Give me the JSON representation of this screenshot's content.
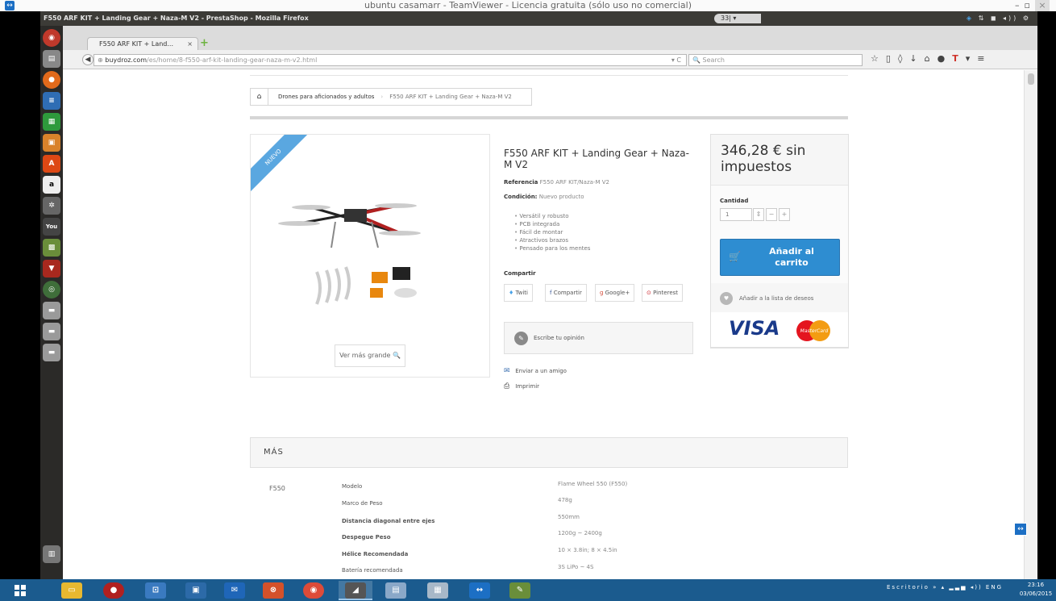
{
  "teamviewer": {
    "title": "ubuntu casamarr - TeamViewer - Licencia gratuita (sólo uso no comercial)"
  },
  "ubuntu_panel": {
    "window_title": "F550 ARF KIT + Landing Gear + Naza-M V2 - PrestaShop - Mozilla Firefox",
    "keyboard": "33|"
  },
  "browser": {
    "tab_label": "F550 ARF KIT + Land...",
    "tab_close": "×",
    "new_tab": "+",
    "url_host": "buydroz.com",
    "url_path": "/es/home/8-f550-arf-kit-landing-gear-naza-m-v2.html",
    "search_placeholder": "Search"
  },
  "breadcrumb": {
    "home_icon": "home-icon",
    "category": "Drones para aficionados y adultos",
    "current": "F550 ARF KIT + Landing Gear + Naza-M V2"
  },
  "product": {
    "new_badge": "NUEVO",
    "view_larger": "Ver más grande",
    "title": "F550 ARF KIT + Landing Gear + Naza-M V2",
    "reference_label": "Referencia",
    "reference_value": "F550 ARF KIT/Naza-M V2",
    "condition_label": "Condición:",
    "condition_value": "Nuevo producto",
    "features": [
      "Versátil y robusto",
      "PCB integrada",
      "Fácil de montar",
      "Atractivos brazos",
      "Pensado para los mentes"
    ],
    "share_label": "Compartir",
    "share": {
      "tweet": "Twiti",
      "facebook": "Compartir",
      "google": "Google+",
      "pinterest": "Pinterest"
    },
    "review": "Escribe tu opinión",
    "send_friend": "Enviar a un amigo",
    "print": "Imprimir"
  },
  "buy": {
    "price": "346,28 € sin impuestos",
    "quantity_label": "Cantidad",
    "quantity_value": "1",
    "add_to_cart": "Añadir al carrito",
    "wishlist": "Añadir a la lista de deseos"
  },
  "more": {
    "title": "MÁS",
    "model": "F550",
    "specs": [
      {
        "label": "Modelo",
        "value": "Flame Wheel 550 (F550)"
      },
      {
        "label": "Marco de Peso",
        "value": "478g"
      },
      {
        "label": "Distancia diagonal entre ejes",
        "value": "550mm"
      },
      {
        "label": "Despegue Peso",
        "value": "1200g ~ 2400g"
      },
      {
        "label": "Hélice Recomendada",
        "value": "10 × 3.8in; 8 × 4.5in"
      },
      {
        "label": "Batería recomendada",
        "value": "3S LiPo ~ 4S"
      }
    ]
  },
  "taskbar": {
    "desktop": "Escritorio",
    "time": "23:16",
    "date": "03/06/2015"
  }
}
